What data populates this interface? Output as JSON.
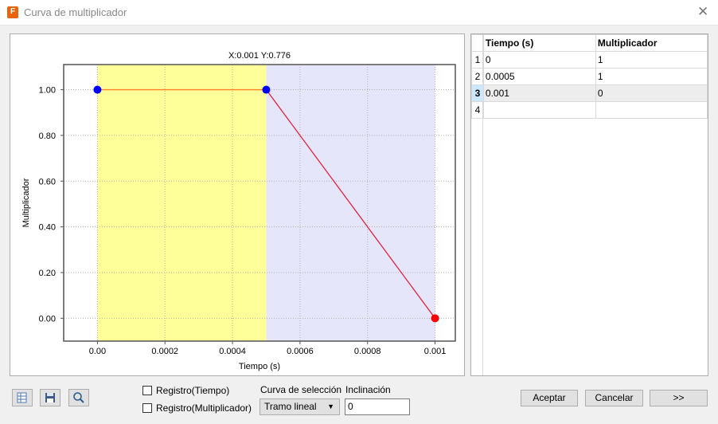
{
  "window": {
    "title": "Curva de multiplicador",
    "icon": "app-icon-f",
    "icon_letter": "F"
  },
  "chart_data": {
    "type": "line",
    "title": "X:0.001 Y:0.776",
    "xlabel": "Tiempo (s)",
    "ylabel": "Multiplicador",
    "xlim": [
      -0.0001,
      0.00106
    ],
    "ylim": [
      -0.1,
      1.11
    ],
    "xticks": [
      "0.00",
      "0.0002",
      "0.0004",
      "0.0006",
      "0.0008",
      "0.001"
    ],
    "xtick_values": [
      0,
      0.0002,
      0.0004,
      0.0006,
      0.0008,
      0.001
    ],
    "yticks": [
      "0.00",
      "0.20",
      "0.40",
      "0.60",
      "0.80",
      "1.00"
    ],
    "ytick_values": [
      0,
      0.2,
      0.4,
      0.6,
      0.8,
      1.0
    ],
    "grid": true,
    "points": [
      {
        "x": 0,
        "y": 1,
        "color": "#0000ff"
      },
      {
        "x": 0.0005,
        "y": 1,
        "color": "#0000ff"
      },
      {
        "x": 0.001,
        "y": 0,
        "color": "#ff0000"
      }
    ],
    "segments": [
      {
        "x0": 0,
        "y0": 1,
        "x1": 0.0005,
        "y1": 1,
        "color": "#ff7f27"
      },
      {
        "x0": 0.0005,
        "y0": 1,
        "x1": 0.001,
        "y1": 0,
        "color": "#e0203a"
      }
    ],
    "regions": [
      {
        "x0": 0,
        "x1": 0.0005,
        "color": "#ffff99"
      },
      {
        "x0": 0.0005,
        "x1": 0.001,
        "color": "#e6e6fa"
      }
    ]
  },
  "table": {
    "columns": [
      "Tiempo (s)",
      "Multiplicador"
    ],
    "rows": [
      {
        "num": "1",
        "tiempo": "0",
        "mult": "1"
      },
      {
        "num": "2",
        "tiempo": "0.0005",
        "mult": "1"
      },
      {
        "num": "3",
        "tiempo": "0.001",
        "mult": "0"
      },
      {
        "num": "4",
        "tiempo": "",
        "mult": ""
      }
    ],
    "selected_row": 3
  },
  "toolbar": {
    "icons": [
      "table-edit-icon",
      "save-icon",
      "zoom-icon"
    ]
  },
  "options": {
    "log_time_label": "Registro(Tiempo)",
    "log_mult_label": "Registro(Multiplicador)",
    "curve_label": "Curva de selección",
    "curve_value": "Tramo lineal",
    "slope_label": "Inclinación",
    "slope_value": "0"
  },
  "buttons": {
    "accept": "Aceptar",
    "cancel": "Cancelar",
    "more": ">>"
  }
}
